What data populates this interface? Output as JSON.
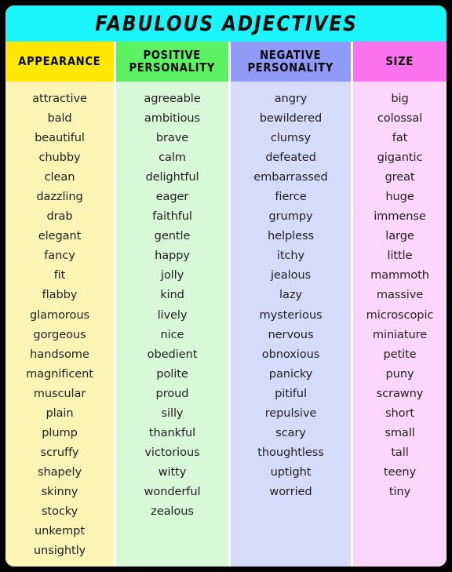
{
  "poster": {
    "title": "FABULOUS ADJECTIVES",
    "title_bg": "#19f5fb",
    "border_color": "#000000",
    "text_color": "#221f1f"
  },
  "columns": [
    {
      "header": "APPEARANCE",
      "header_bg": "#ffe800",
      "body_bg": "#fcf4b5",
      "words": [
        "attractive",
        "bald",
        "beautiful",
        "chubby",
        "clean",
        "dazzling",
        "drab",
        "elegant",
        "fancy",
        "fit",
        "flabby",
        "glamorous",
        "gorgeous",
        "handsome",
        "magnificent",
        "muscular",
        "plain",
        "plump",
        "scruffy",
        "shapely",
        "skinny",
        "stocky",
        "unkempt",
        "unsightly"
      ]
    },
    {
      "header": "POSITIVE\nPERSONALITY",
      "header_bg": "#5cf263",
      "body_bg": "#d8f8d8",
      "words": [
        "agreeable",
        "ambitious",
        "brave",
        "calm",
        "delightful",
        "eager",
        "faithful",
        "gentle",
        "happy",
        "jolly",
        "kind",
        "lively",
        "nice",
        "obedient",
        "polite",
        "proud",
        "silly",
        "thankful",
        "victorious",
        "witty",
        "wonderful",
        "zealous"
      ]
    },
    {
      "header": "NEGATIVE\nPERSONALITY",
      "header_bg": "#8f9bf7",
      "body_bg": "#d6dbf9",
      "words": [
        "angry",
        "bewildered",
        "clumsy",
        "defeated",
        "embarrassed",
        "fierce",
        "grumpy",
        "helpless",
        "itchy",
        "jealous",
        "lazy",
        "mysterious",
        "nervous",
        "obnoxious",
        "panicky",
        "pitiful",
        "repulsive",
        "scary",
        "thoughtless",
        "uptight",
        "worried"
      ]
    },
    {
      "header": "SIZE",
      "header_bg": "#fd73ee",
      "body_bg": "#fcd6fb",
      "words": [
        "big",
        "colossal",
        "fat",
        "gigantic",
        "great",
        "huge",
        "immense",
        "large",
        "little",
        "mammoth",
        "massive",
        "microscopic",
        "miniature",
        "petite",
        "puny",
        "scrawny",
        "short",
        "small",
        "tall",
        "teeny",
        "tiny"
      ]
    }
  ]
}
